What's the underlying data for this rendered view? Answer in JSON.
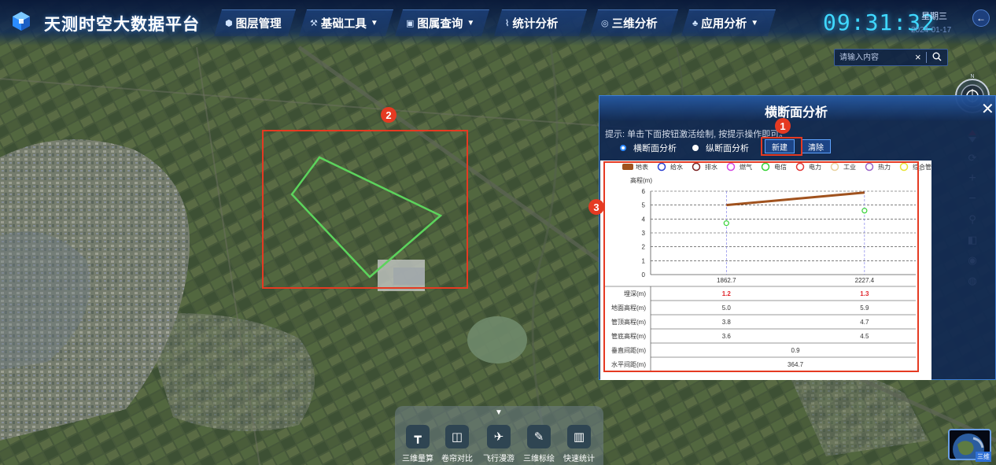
{
  "app": {
    "title": "天测时空大数据平台"
  },
  "nav": [
    {
      "label": "图层管理",
      "icon": "layers-icon",
      "glyph": "⬢",
      "dropdown": false
    },
    {
      "label": "基础工具",
      "icon": "tools-icon",
      "glyph": "⚒",
      "dropdown": true
    },
    {
      "label": "图属查询",
      "icon": "query-icon",
      "glyph": "▣",
      "dropdown": true
    },
    {
      "label": "统计分析",
      "icon": "stats-icon",
      "glyph": "⌇",
      "dropdown": false
    },
    {
      "label": "三维分析",
      "icon": "3d-icon",
      "glyph": "◎",
      "dropdown": false
    },
    {
      "label": "应用分析",
      "icon": "app-icon",
      "glyph": "♣",
      "dropdown": true
    }
  ],
  "clock": {
    "time": "09:31:32",
    "weekday": "星期三",
    "date": "2024-01-17"
  },
  "search": {
    "placeholder": "请输入内容",
    "value": ""
  },
  "panel": {
    "title": "横断面分析",
    "hint": "提示: 单击下面按钮激活绘制, 按提示操作即可。",
    "radio_cross": "横断面分析",
    "radio_long": "纵断面分析",
    "radio_selected": "横断面分析",
    "btn_new": "新建",
    "btn_clear": "清除"
  },
  "annotations": {
    "badge1": "1",
    "badge2": "2",
    "badge3": "3"
  },
  "chart_data": {
    "type": "line",
    "legend": [
      {
        "name": "地表",
        "color": "#a0521e",
        "shape": "rect"
      },
      {
        "name": "给水",
        "color": "#2b3fd0",
        "shape": "circle"
      },
      {
        "name": "排水",
        "color": "#7a2222",
        "shape": "circle"
      },
      {
        "name": "燃气",
        "color": "#d448e0",
        "shape": "circle"
      },
      {
        "name": "电信",
        "color": "#36d236",
        "shape": "circle"
      },
      {
        "name": "电力",
        "color": "#e03636",
        "shape": "circle"
      },
      {
        "name": "工业",
        "color": "#e8d2a0",
        "shape": "circle"
      },
      {
        "name": "热力",
        "color": "#9a66c8",
        "shape": "circle"
      },
      {
        "name": "综合管沟",
        "color": "#e8e436",
        "shape": "circle"
      }
    ],
    "ylabel": "高程(m)",
    "ylim": [
      0,
      6
    ],
    "yticks": [
      "0",
      "1",
      "2",
      "3",
      "4",
      "5",
      "6"
    ],
    "x": [
      1862.7,
      2227.4
    ],
    "xtick_labels": [
      "1862.7",
      "2227.4"
    ],
    "series": [
      {
        "name": "地表",
        "values": [
          5.0,
          5.9
        ]
      }
    ],
    "points": [
      {
        "x": 1862.7,
        "y": 3.7
      },
      {
        "x": 2227.4,
        "y": 4.6
      }
    ],
    "table": {
      "rows": [
        {
          "label": "埋深(m)",
          "values": [
            "1.2",
            "1.3"
          ],
          "highlight": true
        },
        {
          "label": "地面高程(m)",
          "values": [
            "5.0",
            "5.9"
          ],
          "highlight": false
        },
        {
          "label": "管顶高程(m)",
          "values": [
            "3.8",
            "4.7"
          ],
          "highlight": false
        },
        {
          "label": "管底高程(m)",
          "values": [
            "3.6",
            "4.5"
          ],
          "highlight": false
        },
        {
          "label": "垂直间距(m)",
          "values": [
            "0.9",
            ""
          ],
          "highlight": false
        },
        {
          "label": "水平间距(m)",
          "values": [
            "364.7",
            ""
          ],
          "highlight": false
        }
      ]
    }
  },
  "bottom_tools": [
    {
      "label": "三维量算",
      "icon": "measure-icon",
      "glyph": "┳"
    },
    {
      "label": "卷帘对比",
      "icon": "swipe-icon",
      "glyph": "◫"
    },
    {
      "label": "飞行漫游",
      "icon": "flight-icon",
      "glyph": "✈"
    },
    {
      "label": "三维标绘",
      "icon": "plot-icon",
      "glyph": "✎"
    },
    {
      "label": "快速统计",
      "icon": "statistics-icon",
      "glyph": "▥"
    }
  ],
  "minimap": {
    "label": "三维"
  },
  "colors": {
    "accent": "#3fd8ff",
    "annotation": "#e53a22",
    "panel_bg": "#102852",
    "polygon": "#5cd35c"
  }
}
